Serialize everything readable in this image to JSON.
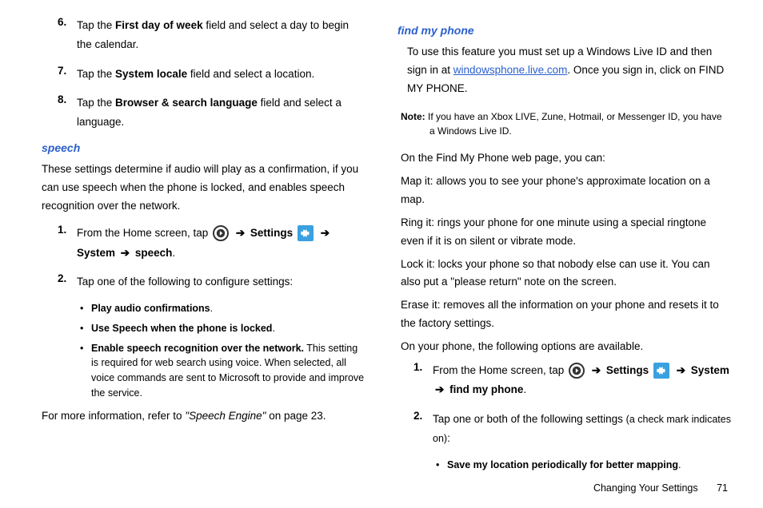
{
  "left": {
    "step6": {
      "num": "6.",
      "pre": "Tap the ",
      "bold": "First day of week",
      "post": " field and select a day to begin the calendar."
    },
    "step7": {
      "num": "7.",
      "pre": "Tap the ",
      "bold": "System locale",
      "post": " field and select a location."
    },
    "step8": {
      "num": "8.",
      "pre": "Tap the ",
      "bold": "Browser & search language",
      "post": " field and select a language."
    },
    "speech_hdr": "speech",
    "speech_intro": "These settings determine if audio will play as a confirmation, if you can use speech when the phone is locked, and enables speech recognition over the network.",
    "speech_s1": {
      "num": "1.",
      "pre": "From the Home screen, tap ",
      "settings": "Settings",
      "system": "System",
      "target": "speech"
    },
    "speech_s2": {
      "num": "2.",
      "text": "Tap one of the following to configure settings:"
    },
    "speech_b1": {
      "bold": "Play audio confirmations",
      "post": "."
    },
    "speech_b2": {
      "bold": "Use Speech when the phone is locked",
      "post": "."
    },
    "speech_b3": {
      "bold": "Enable speech recognition over the network.",
      "post": " This setting is required for web search using voice. When selected, all voice commands are sent to Microsoft to provide and improve the service."
    },
    "speech_more": {
      "pre": "For more information, refer to ",
      "ref": "\"Speech Engine\"",
      "post": "  on page 23."
    }
  },
  "right": {
    "find_hdr": "find my phone",
    "find_intro": {
      "pre": "To use this feature you must set up a Windows Live ID and then sign in at ",
      "link": "windowsphone.live.com",
      "post": ". Once you sign in, click on FIND MY PHONE."
    },
    "note": {
      "label": "Note:",
      "text": " If you have an Xbox LIVE, Zune, Hotmail, or Messenger ID, you have a Windows Live ID."
    },
    "p1": "On the Find My Phone web page, you can:",
    "p2": "Map it: allows you to see your phone's approximate location on a map.",
    "p3": "Ring it: rings your phone for one minute using a special ringtone even if it is on silent or vibrate mode.",
    "p4": "Lock it: locks your phone so that nobody else can use it. You can also put a \"please return\" note on the screen.",
    "p5": "Erase it: removes all the information on your phone and resets it to the factory settings.",
    "p6": "On your phone, the following options are available.",
    "find_s1": {
      "num": "1.",
      "pre": "From the Home screen, tap ",
      "settings": "Settings",
      "system": "System",
      "target": "find my phone"
    },
    "find_s2": {
      "num": "2.",
      "pre": "Tap one or both of the following settings ",
      "paren": "(a check mark indicates on)",
      "post": ":"
    },
    "find_b1": {
      "bold": "Save my location periodically for better mapping",
      "post": "."
    }
  },
  "footer": {
    "title": "Changing Your Settings",
    "page": "71"
  },
  "glyph": {
    "arrow": "➔",
    "bullet": "•"
  }
}
